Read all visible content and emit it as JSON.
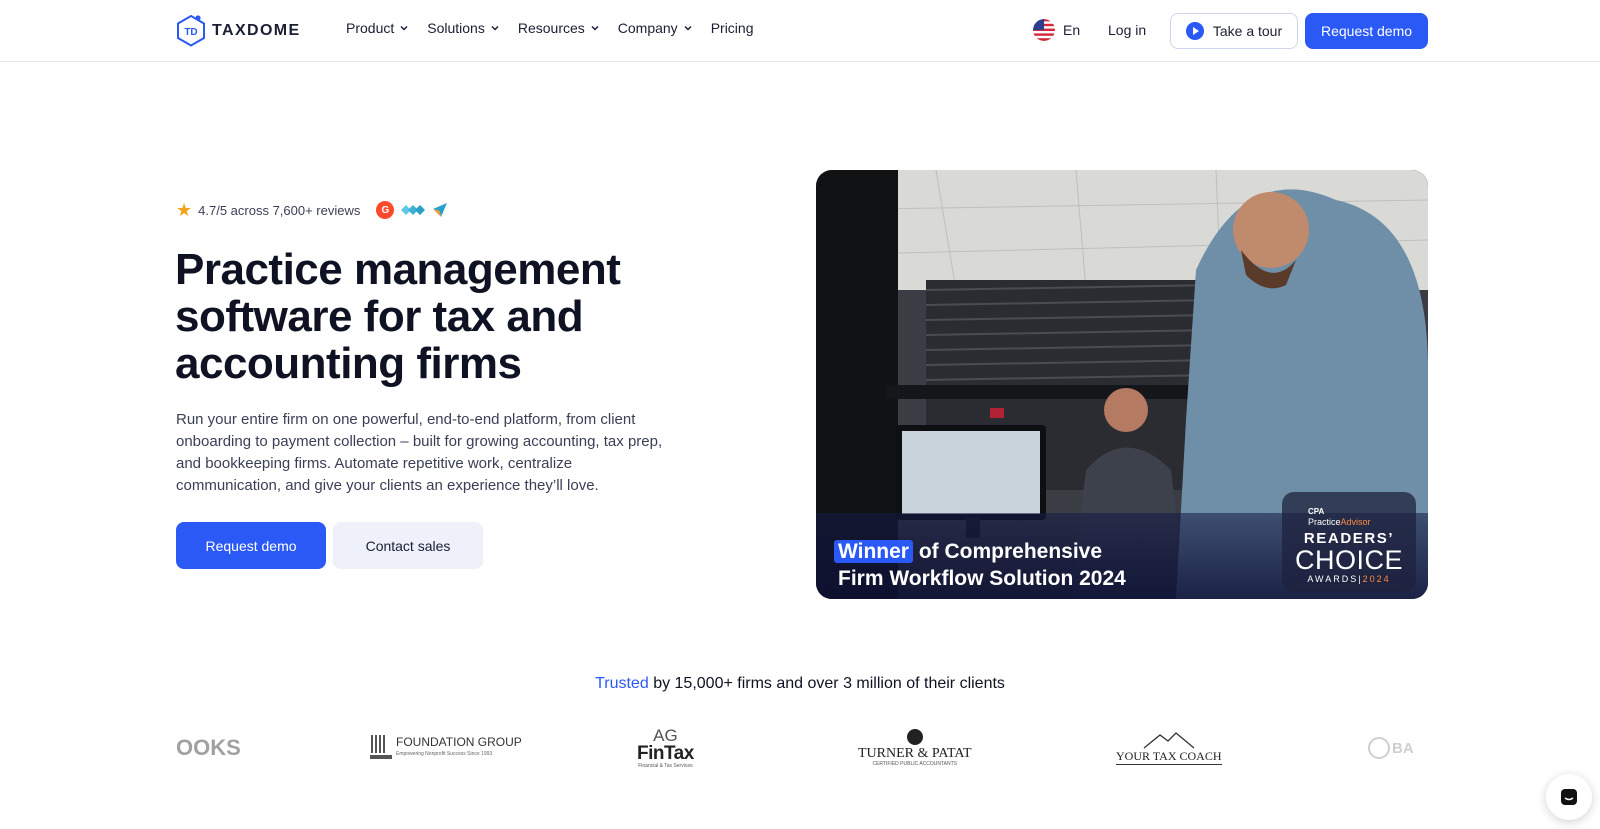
{
  "brand": {
    "name": "TAXDOME",
    "mark": "TD",
    "accent": "#2b59f5"
  },
  "nav": {
    "items": [
      {
        "label": "Product",
        "has_menu": true
      },
      {
        "label": "Solutions",
        "has_menu": true
      },
      {
        "label": "Resources",
        "has_menu": true
      },
      {
        "label": "Company",
        "has_menu": true
      },
      {
        "label": "Pricing",
        "has_menu": false
      }
    ],
    "language": "En",
    "login": "Log in",
    "tour": "Take a tour",
    "demo": "Request demo"
  },
  "hero": {
    "rating_text": "4.7/5 across 7,600+ reviews",
    "review_sites": [
      "g2-logo",
      "capterra-logo",
      "getapp-logo"
    ],
    "headline_lines": [
      "Practice management",
      "software for tax and",
      "accounting firms"
    ],
    "subtext_lines": [
      "Run your entire firm on one powerful, end-to-end platform, from client",
      "onboarding to payment collection – built for growing accounting, tax prep,",
      "and bookkeeping firms. Automate repetitive work, centralize",
      "communication, and give your clients an experience they’ll love."
    ],
    "cta_primary": "Request demo",
    "cta_secondary": "Contact sales"
  },
  "media": {
    "caption_highlight": "Winner",
    "caption_rest": "of Comprehensive",
    "caption_line2": "Firm Workflow Solution 2024",
    "award": {
      "org_small": "CPA",
      "org_name_a": "Practice",
      "org_name_b": "Advisor",
      "readers": "READERS’",
      "choice": "CHOICE",
      "awards": "AWARDS",
      "year": "2024"
    }
  },
  "trusted": {
    "accent": "Trusted",
    "rest": "by 15,000+ firms and over 3 million of their clients"
  },
  "clients": [
    {
      "name": "OOKS"
    },
    {
      "name": "FOUNDATION GROUP",
      "tag": "Empowering Nonprofit Success Since 1993"
    },
    {
      "name": "FinTax",
      "top": "AG",
      "tag": "Financial & Tax Services"
    },
    {
      "name": "TURNER & PATAT",
      "tag": "CERTIFIED PUBLIC ACCOUNTANTS"
    },
    {
      "name": "YOUR TAX COACH"
    },
    {
      "name": "BA"
    }
  ]
}
